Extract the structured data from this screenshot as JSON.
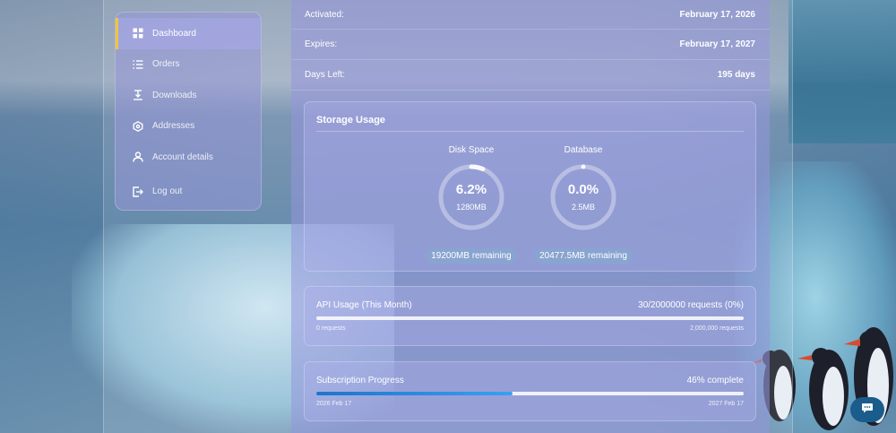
{
  "sidebar": {
    "items": [
      {
        "label": "Dashboard",
        "icon": "grid-icon",
        "active": true
      },
      {
        "label": "Orders",
        "icon": "list-icon"
      },
      {
        "label": "Downloads",
        "icon": "download-icon"
      },
      {
        "label": "Addresses",
        "icon": "location-icon"
      },
      {
        "label": "Account details",
        "icon": "user-icon"
      },
      {
        "label": "Log out",
        "icon": "logout-icon"
      }
    ]
  },
  "subscription_info": {
    "activated_label": "Activated:",
    "activated_value": "February 17, 2026",
    "expires_label": "Expires:",
    "expires_value": "February 17, 2027",
    "days_left_label": "Days Left:",
    "days_left_value": "195 days"
  },
  "storage": {
    "title": "Storage Usage",
    "disk": {
      "label": "Disk Space",
      "percent_text": "6.2%",
      "percent": 0.062,
      "size": "1280MB",
      "remaining": "19200MB remaining"
    },
    "database": {
      "label": "Database",
      "percent_text": "0.0%",
      "percent": 0.0,
      "size": "2.5MB",
      "remaining": "20477.5MB remaining"
    }
  },
  "api_usage": {
    "title": "API Usage (This Month)",
    "summary": "30/2000000 requests (0%)",
    "fraction": 0.0,
    "min_label": "0 requests",
    "max_label": "2,000,000 requests"
  },
  "subscription_progress": {
    "title": "Subscription Progress",
    "summary": "46% complete",
    "fraction": 0.46,
    "start_label": "2026 Feb 17",
    "end_label": "2027 Feb 17"
  },
  "colors": {
    "accent_active": "#f2c440",
    "progress_blue": "#1f74c9",
    "chat_button": "#1a5c8c"
  },
  "chat": {
    "icon": "chat-bubble-icon"
  }
}
